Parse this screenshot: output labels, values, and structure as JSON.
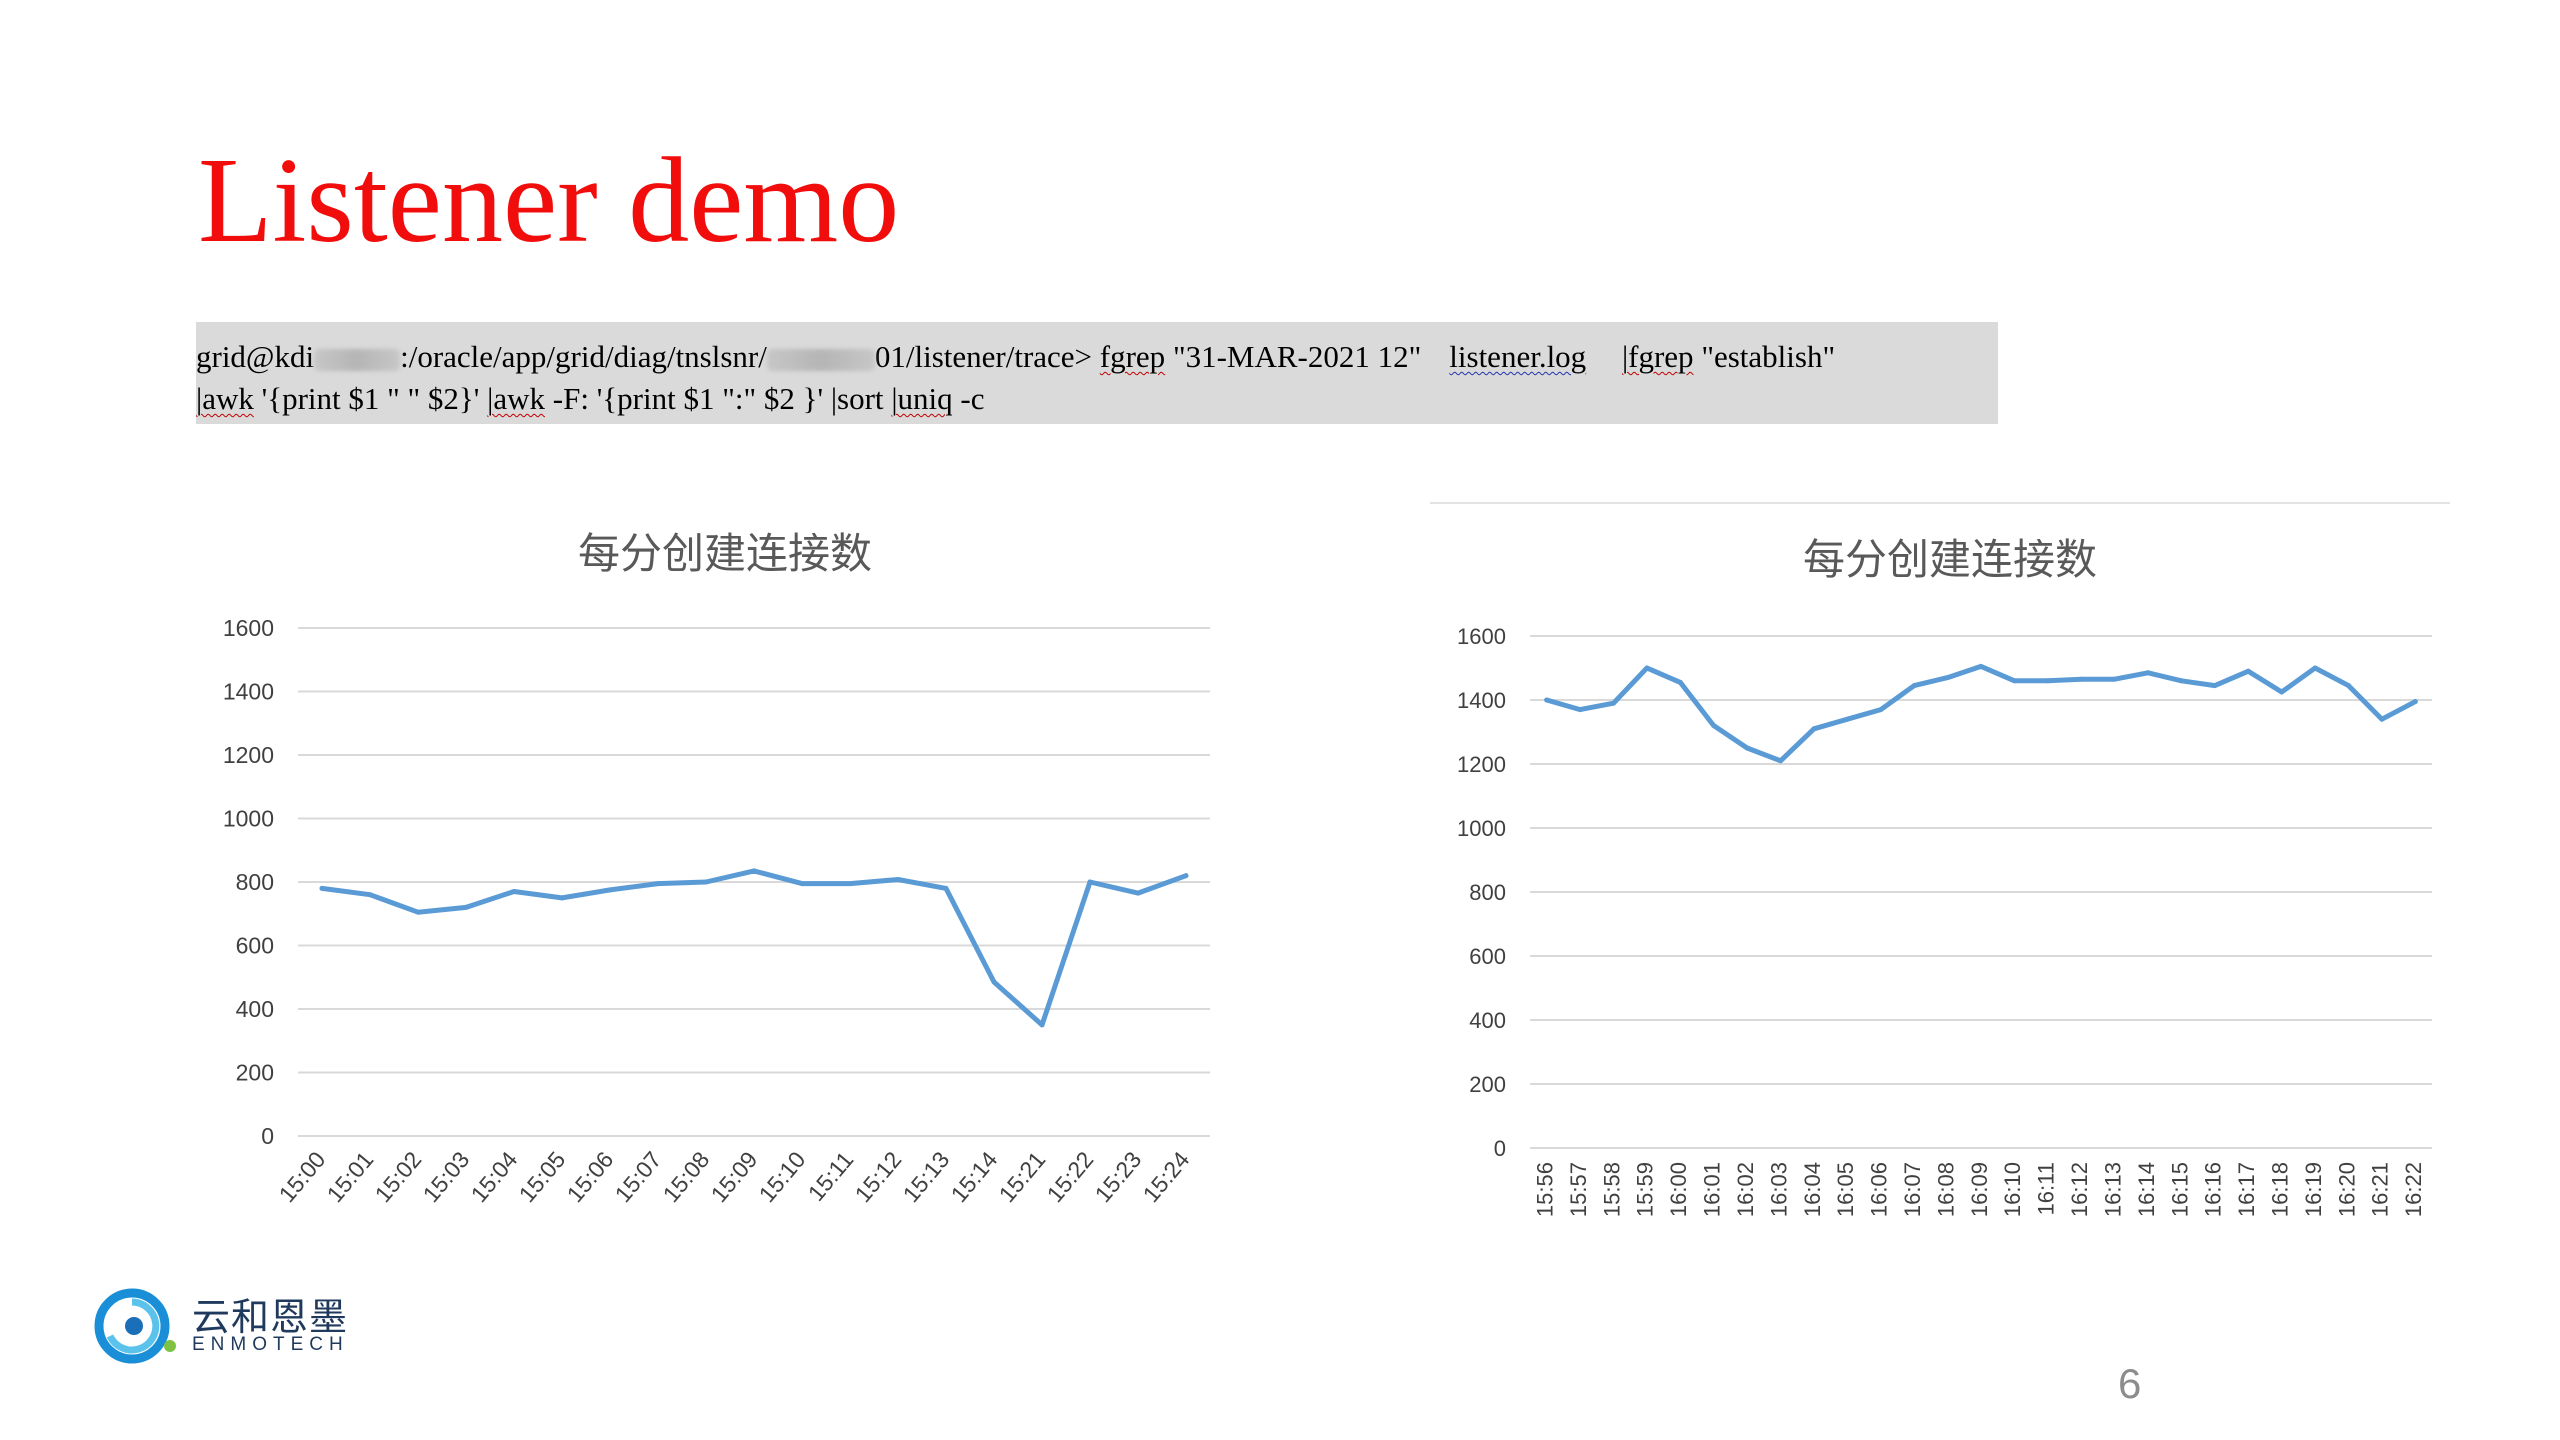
{
  "slide": {
    "title": "Listener demo",
    "page_number": "6"
  },
  "command": {
    "line1_prefix": "grid@kdi",
    "line1_mid": ":/oracle/app/grid/diag/tnslsnr/",
    "line1_tail": "01/listener/trace>",
    "cmd_fgrep": "fgrep",
    "cmd_pattern": "\"31-MAR-2021 12\"",
    "cmd_logfile": "listener.log",
    "cmd_pipe_fgrep": "|fgrep",
    "cmd_establish": "\"establish\"",
    "line2_awk1": "|awk",
    "line2_print1": "'{print $1 \" \" $2}'",
    "line2_awk2": "|awk",
    "line2_print2": "-F: '{print $1 \":\" $2 }'",
    "line2_sort": "|sort",
    "line2_uniq": "|uniq",
    "line2_flag": "-c"
  },
  "logo": {
    "name_cn": "云和恩墨",
    "name_en": "ENMOTECH"
  },
  "colors": {
    "title_red": "#f20d0d",
    "line_blue": "#5b9bd5",
    "grid_gray": "#d9d9d9"
  },
  "chart_data": [
    {
      "type": "line",
      "title": "每分创建连接数",
      "xlabel": "",
      "ylabel": "",
      "ylim": [
        0,
        1600
      ],
      "yticks": [
        0,
        200,
        400,
        600,
        800,
        1000,
        1200,
        1400,
        1600
      ],
      "grid": true,
      "categories": [
        "15:00",
        "15:01",
        "15:02",
        "15:03",
        "15:04",
        "15:05",
        "15:06",
        "15:07",
        "15:08",
        "15:09",
        "15:10",
        "15:11",
        "15:12",
        "15:13",
        "15:14",
        "15:21",
        "15:22",
        "15:23",
        "15:24"
      ],
      "series": [
        {
          "values": [
            780,
            760,
            705,
            720,
            770,
            750,
            775,
            795,
            800,
            835,
            795,
            795,
            808,
            780,
            485,
            350,
            800,
            765,
            820
          ]
        }
      ]
    },
    {
      "type": "line",
      "title": "每分创建连接数",
      "xlabel": "",
      "ylabel": "",
      "ylim": [
        0,
        1600
      ],
      "yticks": [
        0,
        200,
        400,
        600,
        800,
        1000,
        1200,
        1400,
        1600
      ],
      "grid": true,
      "categories": [
        "15:56",
        "15:57",
        "15:58",
        "15:59",
        "16:00",
        "16:01",
        "16:02",
        "16:03",
        "16:04",
        "16:05",
        "16:06",
        "16:07",
        "16:08",
        "16:09",
        "16:10",
        "16:11",
        "16:12",
        "16:13",
        "16:14",
        "16:15",
        "16:16",
        "16:17",
        "16:18",
        "16:19",
        "16:20",
        "16:21",
        "16:22"
      ],
      "series": [
        {
          "values": [
            1400,
            1370,
            1390,
            1500,
            1455,
            1320,
            1250,
            1210,
            1310,
            1340,
            1370,
            1445,
            1470,
            1505,
            1460,
            1460,
            1465,
            1465,
            1485,
            1460,
            1445,
            1490,
            1425,
            1500,
            1445,
            1340,
            1395
          ]
        }
      ]
    }
  ]
}
